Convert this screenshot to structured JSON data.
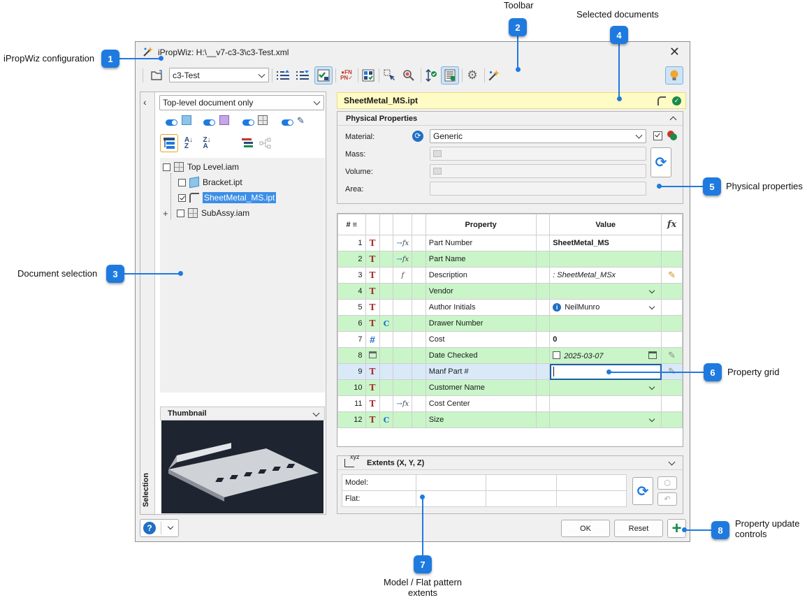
{
  "annotations": {
    "c1": "iPropWiz configuration",
    "c2": "Toolbar",
    "c3": "Document selection",
    "c4": "Selected documents",
    "c5": "Physical properties",
    "c6": "Property grid",
    "c7": "Model / Flat pattern extents",
    "c8": "Property update controls",
    "n1": "1",
    "n2": "2",
    "n3": "3",
    "n4": "4",
    "n5": "5",
    "n6": "6",
    "n7": "7",
    "n8": "8"
  },
  "window": {
    "title": "iPropWiz: H:\\__v7-c3-3\\c3-Test.xml",
    "close": "✕"
  },
  "toolbar": {
    "config_value": "c3-Test"
  },
  "left": {
    "filter_value": "Top-level document only",
    "tab_label": "Selection",
    "tree": [
      {
        "label": "Top Level.iam",
        "checked": false
      },
      {
        "label": "Bracket.ipt",
        "checked": false
      },
      {
        "label": "SheetMetal_MS.ipt",
        "checked": true
      },
      {
        "label": "SubAssy.iam",
        "checked": false
      }
    ],
    "thumbnail_label": "Thumbnail"
  },
  "selected_doc": "SheetMetal_MS.ipt",
  "physical": {
    "title": "Physical Properties",
    "material_label": "Material:",
    "material_value": "Generic",
    "mass_label": "Mass:",
    "volume_label": "Volume:",
    "area_label": "Area:"
  },
  "grid": {
    "headers": {
      "num": "#",
      "property": "Property",
      "value": "Value"
    },
    "rows": [
      {
        "n": "1",
        "prop": "Part Number",
        "value": "SheetMetal_MS"
      },
      {
        "n": "2",
        "prop": "Part Name",
        "value": ""
      },
      {
        "n": "3",
        "prop": "Description",
        "value": ": SheetMetal_MSx"
      },
      {
        "n": "4",
        "prop": "Vendor",
        "value": ""
      },
      {
        "n": "5",
        "prop": "Author Initials",
        "value": "NeilMunro"
      },
      {
        "n": "6",
        "prop": "Drawer Number",
        "value": ""
      },
      {
        "n": "7",
        "prop": "Cost",
        "value": "0"
      },
      {
        "n": "8",
        "prop": "Date Checked",
        "value": "2025-03-07"
      },
      {
        "n": "9",
        "prop": "Manf Part #",
        "value": ""
      },
      {
        "n": "10",
        "prop": "Customer Name",
        "value": ""
      },
      {
        "n": "11",
        "prop": "Cost Center",
        "value": ""
      },
      {
        "n": "12",
        "prop": "Size",
        "value": ""
      }
    ]
  },
  "extents": {
    "title": "Extents (X, Y, Z)",
    "xyz": "xyz",
    "model_label": "Model:",
    "flat_label": "Flat:"
  },
  "footer": {
    "ok": "OK",
    "reset": "Reset"
  }
}
